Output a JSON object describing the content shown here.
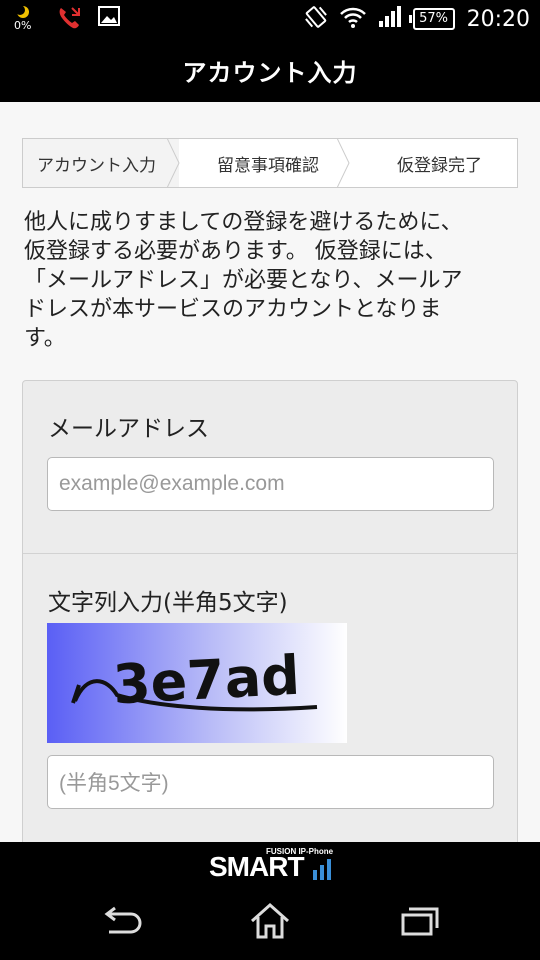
{
  "status_bar": {
    "battery_small_pct": "0%",
    "battery_pct": "57%",
    "time": "20:20",
    "icons": [
      "moon-icon",
      "missed-call-icon",
      "image-icon",
      "vibrate-icon",
      "wifi-icon",
      "signal-icon",
      "battery-icon"
    ]
  },
  "header": {
    "title": "アカウント入力"
  },
  "steps": [
    {
      "label": "アカウント入力",
      "active": true
    },
    {
      "label": "留意事項確認",
      "active": false
    },
    {
      "label": "仮登録完了",
      "active": false
    }
  ],
  "intro": {
    "lines": [
      "他人に成りすましての登録を避けるために、",
      "仮登録する必要があります。 仮登録には、",
      "「メールアドレス」が必要となり、メールア",
      "ドレスが本サービスのアカウントとなりま",
      "す。"
    ]
  },
  "form": {
    "email": {
      "label": "メールアドレス",
      "placeholder": "example@example.com",
      "value": ""
    },
    "captcha": {
      "label": "文字列入力(半角5文字)",
      "image_text": "3e7ad",
      "placeholder": "(半角5文字)",
      "value": ""
    }
  },
  "brand": {
    "sub": "FUSION IP-Phone",
    "name": "SMART"
  },
  "nav": {
    "buttons": [
      "back-icon",
      "home-icon",
      "recent-apps-icon"
    ]
  },
  "colors": {
    "background": "#f7f7f7",
    "bar": "#000000",
    "captcha_gradient_start": "#5a5ff5",
    "captcha_gradient_end": "#ffffff",
    "brand_bars": "#3a8fd8"
  }
}
